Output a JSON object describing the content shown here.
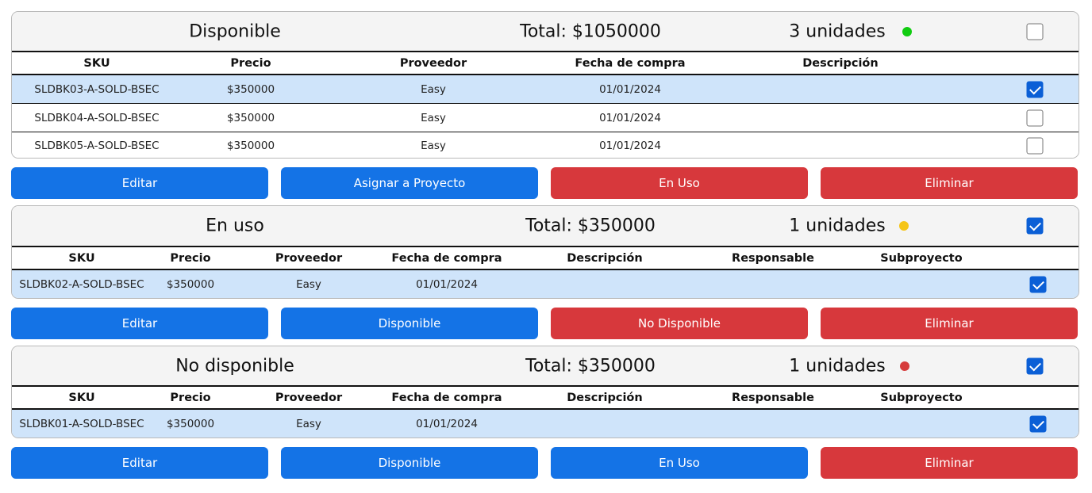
{
  "colors": {
    "primary": "#1473e6",
    "danger": "#d7383c",
    "selected_row": "#cfe4fa",
    "header_bg": "#f4f4f4"
  },
  "sections": [
    {
      "status": "Disponible",
      "total": "Total: $1050000",
      "units": "3 unidades",
      "dot_color": "#11cc11",
      "header_checked": false,
      "columns": [
        "SKU",
        "Precio",
        "Proveedor",
        "Fecha de compra",
        "Descripción"
      ],
      "rows": [
        {
          "sku": "SLDBK03-A-SOLD-BSEC",
          "precio": "$350000",
          "proveedor": "Easy",
          "fecha": "01/01/2024",
          "descripcion": "",
          "checked": true
        },
        {
          "sku": "SLDBK04-A-SOLD-BSEC",
          "precio": "$350000",
          "proveedor": "Easy",
          "fecha": "01/01/2024",
          "descripcion": "",
          "checked": false
        },
        {
          "sku": "SLDBK05-A-SOLD-BSEC",
          "precio": "$350000",
          "proveedor": "Easy",
          "fecha": "01/01/2024",
          "descripcion": "",
          "checked": false
        }
      ],
      "buttons": [
        {
          "label": "Editar",
          "style": "blue"
        },
        {
          "label": "Asignar a Proyecto",
          "style": "blue"
        },
        {
          "label": "En Uso",
          "style": "red"
        },
        {
          "label": "Eliminar",
          "style": "red"
        }
      ]
    },
    {
      "status": "En uso",
      "total": "Total: $350000",
      "units": "1 unidades",
      "dot_color": "#f5c518",
      "header_checked": true,
      "columns": [
        "SKU",
        "Precio",
        "Proveedor",
        "Fecha de compra",
        "Descripción",
        "Responsable",
        "Subproyecto"
      ],
      "rows": [
        {
          "sku": "SLDBK02-A-SOLD-BSEC",
          "precio": "$350000",
          "proveedor": "Easy",
          "fecha": "01/01/2024",
          "descripcion": "",
          "responsable": "",
          "subproyecto": "",
          "checked": true
        }
      ],
      "buttons": [
        {
          "label": "Editar",
          "style": "blue"
        },
        {
          "label": "Disponible",
          "style": "blue"
        },
        {
          "label": "No Disponible",
          "style": "red"
        },
        {
          "label": "Eliminar",
          "style": "red"
        }
      ]
    },
    {
      "status": "No disponible",
      "total": "Total: $350000",
      "units": "1 unidades",
      "dot_color": "#d63b3b",
      "header_checked": true,
      "columns": [
        "SKU",
        "Precio",
        "Proveedor",
        "Fecha de compra",
        "Descripción",
        "Responsable",
        "Subproyecto"
      ],
      "rows": [
        {
          "sku": "SLDBK01-A-SOLD-BSEC",
          "precio": "$350000",
          "proveedor": "Easy",
          "fecha": "01/01/2024",
          "descripcion": "",
          "responsable": "",
          "subproyecto": "",
          "checked": true
        }
      ],
      "buttons": [
        {
          "label": "Editar",
          "style": "blue"
        },
        {
          "label": "Disponible",
          "style": "blue"
        },
        {
          "label": "En Uso",
          "style": "blue"
        },
        {
          "label": "Eliminar",
          "style": "red"
        }
      ]
    }
  ]
}
